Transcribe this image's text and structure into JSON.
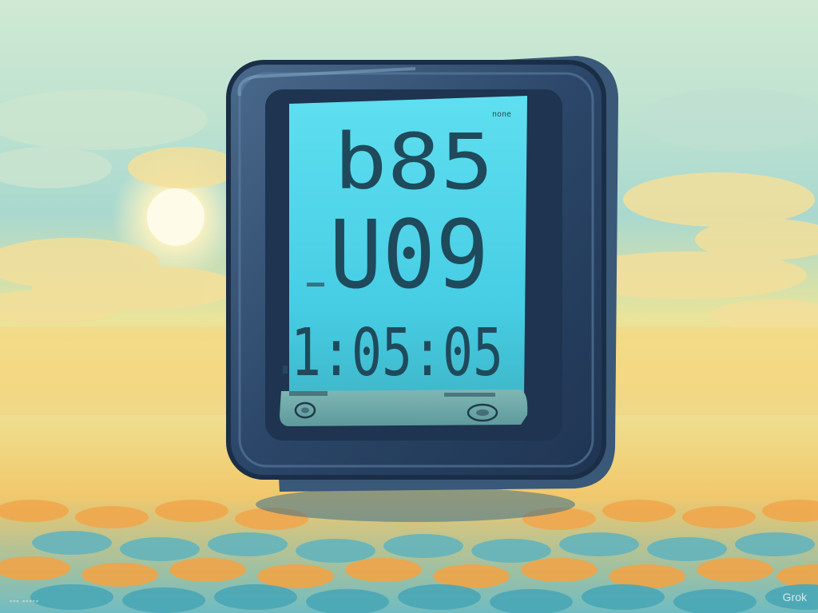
{
  "scene": {
    "subject": "digital-lcd-clock",
    "colors": {
      "sky_top": "#cfe9d4",
      "horizon_glow": "#f3d37a",
      "water": "#7cc2c4",
      "device_body": "#2e4a6b",
      "lcd": "#4fd4ea",
      "digits": "#1f4a5c"
    }
  },
  "lcd": {
    "row1": "b85",
    "row2": "U09",
    "row3": "1:05:05",
    "corner_label": "none"
  },
  "watermark": "Grok"
}
